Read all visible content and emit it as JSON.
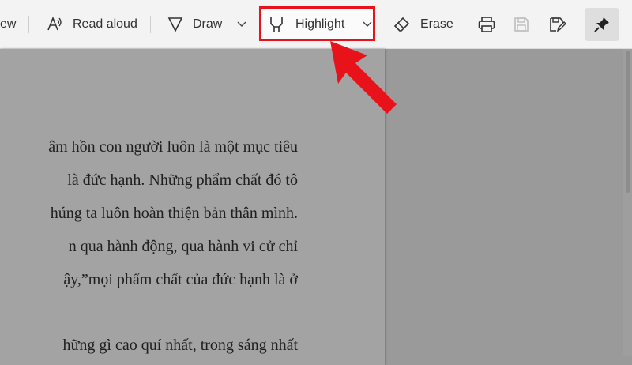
{
  "toolbar": {
    "view_partial": "ew",
    "read_aloud": "Read aloud",
    "draw": "Draw",
    "highlight": "Highlight",
    "erase": "Erase",
    "icons": [
      "read-aloud-icon",
      "draw-icon",
      "chevron-down-icon",
      "highlight-icon",
      "erase-icon",
      "print-icon",
      "save-icon",
      "save-as-icon",
      "pin-icon"
    ]
  },
  "document": {
    "lines": [
      "âm hồn con người luôn là một mục tiêu",
      "là đức hạnh. Những phẩm chất đó tô",
      "húng ta luôn hoàn thiện bản thân mình.",
      "n qua hành động, qua hành vi cử chỉ",
      "ậy,”mọi phẩm chất của đức hạnh là ở",
      "hững gì cao quí nhất, trong sáng nhất"
    ]
  },
  "colors": {
    "highlight_box": "#e8131a",
    "arrow": "#e8131a",
    "overlay": "#9a9a9a"
  }
}
